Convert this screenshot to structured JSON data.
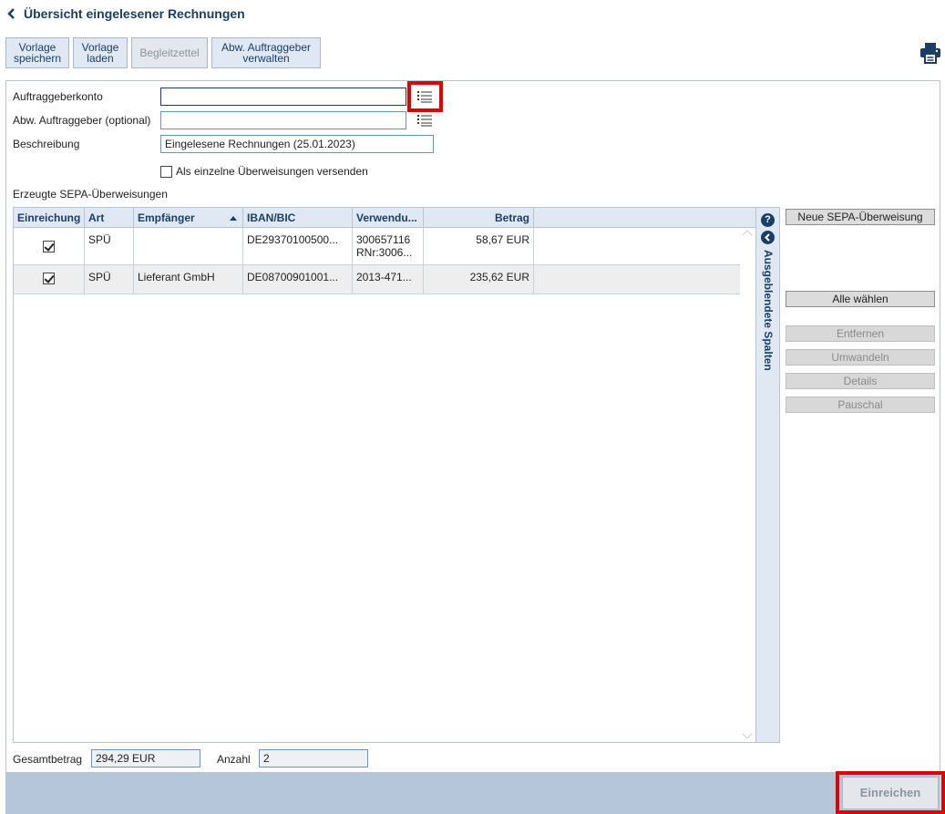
{
  "header": {
    "title": "Übersicht eingelesener Rechnungen"
  },
  "toolbar": {
    "save_template": "Vorlage\nspeichern",
    "load_template": "Vorlage\nladen",
    "cover_note": "Begleitzettel",
    "manage_payer": "Abw. Auftraggeber\nverwalten"
  },
  "form": {
    "account_label": "Auftraggeberkonto",
    "account_value": "",
    "alt_payer_label": "Abw. Auftraggeber (optional)",
    "alt_payer_value": "",
    "description_label": "Beschreibung",
    "description_value": "Eingelesene Rechnungen (25.01.2023)",
    "single_transfers_label": "Als einzelne Überweisungen versenden"
  },
  "grid": {
    "title": "Erzeugte SEPA-Überweisungen",
    "columns": [
      "Einreichung",
      "Art",
      "Empfänger",
      "IBAN/BIC",
      "Verwendu...",
      "Betrag"
    ],
    "rows": [
      {
        "checked": true,
        "art": "SPÜ",
        "recipient": "",
        "iban": "DE29370100500...",
        "purpose1": "300657116",
        "purpose2": "RNr:3006...",
        "amount": "58,67 EUR"
      },
      {
        "checked": true,
        "art": "SPÜ",
        "recipient": "Lieferant GmbH",
        "iban": "DE08700901001...",
        "purpose1": "2013-471...",
        "purpose2": "",
        "amount": "235,62 EUR"
      }
    ],
    "hidden_columns_label": "Ausgeblendete Spalten"
  },
  "side_buttons": {
    "new_transfer": "Neue SEPA-Überweisung",
    "select_all": "Alle wählen",
    "remove": "Entfernen",
    "convert": "Umwandeln",
    "details": "Details",
    "flat": "Pauschal"
  },
  "summary": {
    "total_label": "Gesamtbetrag",
    "total_value": "294,29 EUR",
    "count_label": "Anzahl",
    "count_value": "2"
  },
  "footer": {
    "submit_label": "Einreichen"
  },
  "colors": {
    "primary": "#1a3e66",
    "header_bg": "#dfe8f3",
    "footer_bg": "#b5c6db",
    "highlight": "#e00000"
  }
}
